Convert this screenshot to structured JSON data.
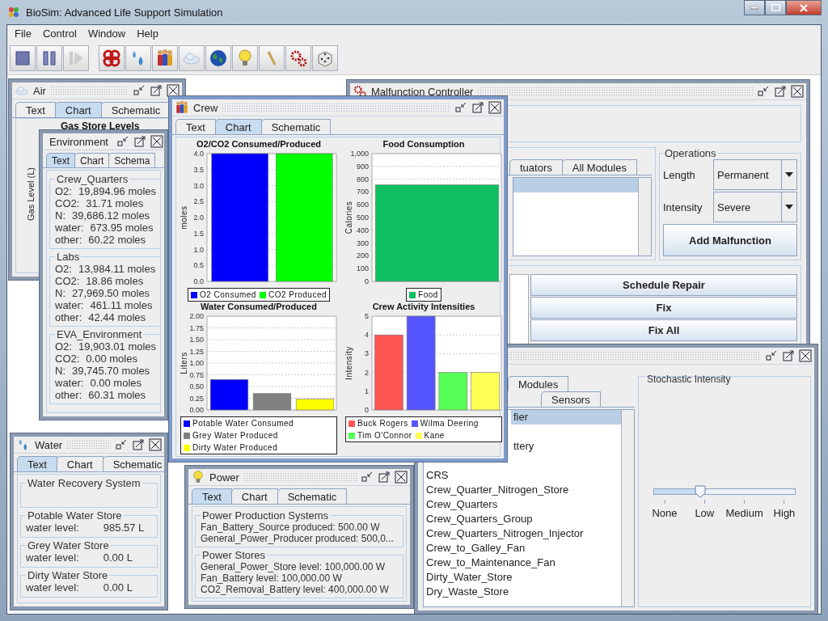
{
  "window": {
    "title": "BioSim: Advanced Life Support Simulation"
  },
  "menu": [
    "File",
    "Control",
    "Window",
    "Help"
  ],
  "toolbar": [
    {
      "kind": "stop",
      "disabled": false
    },
    {
      "kind": "pause",
      "disabled": false
    },
    {
      "kind": "step",
      "disabled": true
    },
    {
      "kind": "knot",
      "disabled": false
    },
    {
      "kind": "drops",
      "disabled": false
    },
    {
      "kind": "people",
      "disabled": false
    },
    {
      "kind": "cloud",
      "disabled": false
    },
    {
      "kind": "globe",
      "disabled": false
    },
    {
      "kind": "bulb",
      "disabled": false
    },
    {
      "kind": "stick",
      "disabled": false
    },
    {
      "kind": "gears",
      "disabled": false
    },
    {
      "kind": "dice",
      "disabled": false
    }
  ],
  "air": {
    "title": "Air",
    "tabs": [
      {
        "label": "Text",
        "selected": false
      },
      {
        "label": "Chart",
        "selected": true
      },
      {
        "label": "Schematic",
        "selected": false
      }
    ],
    "chart_title": "Gas Store Levels",
    "y_axis_label": "Gas Level (L)"
  },
  "malfunction": {
    "title": "Malfunction Controller",
    "tabs": [
      {
        "label": "tuators",
        "selected": false
      },
      {
        "label": "All Modules",
        "selected": false
      }
    ],
    "list_rows": [
      {
        "selected": true
      }
    ],
    "operations": {
      "title": "Operations",
      "fields": [
        {
          "label": "Length",
          "value": "Permanent"
        },
        {
          "label": "Intensity",
          "value": "Severe"
        }
      ],
      "button": "Add Malfunction"
    },
    "actions": [
      "Schedule Repair",
      "Fix",
      "Fix All"
    ]
  },
  "modules": {
    "top_tabs": [
      {
        "label": "Modules",
        "selected": false
      }
    ],
    "tabs": [
      {
        "label": "Sensors",
        "selected": false
      }
    ],
    "items": [
      {
        "label": "fier",
        "selected": true,
        "cut": true
      },
      {
        "label": "ttery",
        "selected": false,
        "cut": true
      },
      {
        "label": "CRS",
        "selected": false,
        "cut": false
      },
      {
        "label": "Crew_Quarter_Nitrogen_Store",
        "selected": false,
        "cut": false
      },
      {
        "label": "Crew_Quarters",
        "selected": false,
        "cut": false
      },
      {
        "label": "Crew_Quarters_Group",
        "selected": false,
        "cut": false
      },
      {
        "label": "Crew_Quarters_Nitrogen_Injector",
        "selected": false,
        "cut": false
      },
      {
        "label": "Crew_to_Galley_Fan",
        "selected": false,
        "cut": false
      },
      {
        "label": "Crew_to_Maintenance_Fan",
        "selected": false,
        "cut": false
      },
      {
        "label": "Dirty_Water_Store",
        "selected": false,
        "cut": false
      },
      {
        "label": "Dry_Waste_Store",
        "selected": false,
        "cut": false
      }
    ],
    "intensity": {
      "title": "Stochastic Intensity",
      "level": 0.33,
      "ticks": [
        "None",
        "Low",
        "Medium",
        "High"
      ]
    }
  },
  "environment": {
    "title": "Environment",
    "tabs": [
      {
        "label": "Text",
        "selected": true
      },
      {
        "label": "Chart",
        "selected": false
      },
      {
        "label": "Schema",
        "selected": false
      }
    ],
    "groups": [
      {
        "title": "Crew_Quarters",
        "rows": [
          {
            "label": "O2:",
            "value": "19,894.96 moles"
          },
          {
            "label": "CO2:",
            "value": "31.71 moles"
          },
          {
            "label": "N:",
            "value": "39,686.12 moles"
          },
          {
            "label": "water:",
            "value": "673.95 moles"
          },
          {
            "label": "other:",
            "value": "60.22 moles"
          }
        ]
      },
      {
        "title": "Labs",
        "rows": [
          {
            "label": "O2:",
            "value": "13,984.11 moles"
          },
          {
            "label": "CO2:",
            "value": "18.86 moles"
          },
          {
            "label": "N:",
            "value": "27,969.50 moles"
          },
          {
            "label": "water:",
            "value": "461.11 moles"
          },
          {
            "label": "other:",
            "value": "42.44 moles"
          }
        ]
      },
      {
        "title": "EVA_Environment",
        "rows": [
          {
            "label": "O2:",
            "value": "19,903.01 moles"
          },
          {
            "label": "CO2:",
            "value": "0.00 moles"
          },
          {
            "label": "N:",
            "value": "39,745.70 moles"
          },
          {
            "label": "water:",
            "value": "0.00 moles"
          },
          {
            "label": "other:",
            "value": "60.31 moles"
          }
        ]
      }
    ]
  },
  "water": {
    "title": "Water",
    "tabs": [
      {
        "label": "Text",
        "selected": true
      },
      {
        "label": "Chart",
        "selected": false
      },
      {
        "label": "Schematic",
        "selected": false
      }
    ],
    "groups": [
      {
        "title": "Water Recovery System"
      },
      {
        "title": "Potable Water Store",
        "rows": [
          {
            "label": "water level:",
            "value": "985.57 L"
          }
        ]
      },
      {
        "title": "Grey Water Store",
        "rows": [
          {
            "label": "water level:",
            "value": "0.00 L"
          }
        ]
      },
      {
        "title": "Dirty Water Store",
        "rows": [
          {
            "label": "water level:",
            "value": "0.00 L"
          }
        ]
      }
    ]
  },
  "power": {
    "title": "Power",
    "tabs": [
      {
        "label": "Text",
        "selected": true
      },
      {
        "label": "Chart",
        "selected": false
      },
      {
        "label": "Schematic",
        "selected": false
      }
    ],
    "groups": [
      {
        "title": "Power Production Systems",
        "lines": [
          "Fan_Battery_Source produced: 500.00 W",
          "General_Power_Producer produced: 500,0..."
        ]
      },
      {
        "title": "Power Stores",
        "lines": [
          "General_Power_Store level: 100,000.00 W",
          "Fan_Battery level: 100,000.00 W",
          "CO2_Removal_Battery level: 400,000.00 W"
        ]
      }
    ]
  },
  "crew": {
    "title": "Crew",
    "tabs": [
      {
        "label": "Text",
        "selected": false
      },
      {
        "label": "Chart",
        "selected": true
      },
      {
        "label": "Schematic",
        "selected": false
      }
    ],
    "charts": [
      {
        "chart_data": {
          "type": "bar",
          "grid": true,
          "title": "O2/CO2 Consumed/Produced",
          "ylabel": "moles",
          "ylim": [
            0,
            4
          ],
          "yticks": [
            {
              "value": 0,
              "label": "0.0"
            },
            {
              "value": 0.5,
              "label": "0.5"
            },
            {
              "value": 1,
              "label": "1.0"
            },
            {
              "value": 1.5,
              "label": "1.5"
            },
            {
              "value": 2,
              "label": "2.0"
            },
            {
              "value": 2.5,
              "label": "2.5"
            },
            {
              "value": 3,
              "label": "3.0"
            },
            {
              "value": 3.5,
              "label": "3.5"
            },
            {
              "value": 4,
              "label": "4.0"
            }
          ],
          "series": [
            {
              "name": "O2 Consumed",
              "color": "#0000ff",
              "values": [
                4.0
              ]
            },
            {
              "name": "CO2 Produced",
              "color": "#00ff00",
              "values": [
                4.0
              ]
            }
          ]
        }
      },
      {
        "chart_data": {
          "type": "bar",
          "grid": true,
          "title": "Food Consumption",
          "ylabel": "Calories",
          "ylim": [
            0,
            1000
          ],
          "yticks": [
            0,
            100,
            200,
            300,
            400,
            500,
            600,
            700,
            800,
            900,
            {
              "value": 1000,
              "label": "1,000"
            }
          ],
          "series": [
            {
              "name": "Food",
              "color": "#10c060",
              "values": [
                755
              ]
            }
          ]
        }
      },
      {
        "chart_data": {
          "type": "bar",
          "grid": true,
          "title": "Water Consumed/Produced",
          "ylabel": "Liters",
          "ylim": [
            0,
            2
          ],
          "yticks": [
            {
              "value": 0,
              "label": "0.00"
            },
            {
              "value": 0.25,
              "label": "0.25"
            },
            {
              "value": 0.5,
              "label": "0.50"
            },
            {
              "value": 0.75,
              "label": "0.75"
            },
            {
              "value": 1,
              "label": "1.00"
            },
            {
              "value": 1.25,
              "label": "1.25"
            },
            {
              "value": 1.5,
              "label": "1.50"
            },
            {
              "value": 1.75,
              "label": "1.75"
            },
            {
              "value": 2,
              "label": "2.00"
            }
          ],
          "series": [
            {
              "name": "Potable Water Consumed",
              "color": "#0000ff",
              "values": [
                0.65
              ]
            },
            {
              "name": "Grey Water Produced",
              "color": "#808080",
              "values": [
                0.35
              ]
            },
            {
              "name": "Dirty Water Produced",
              "color": "#ffff00",
              "values": [
                0.23
              ]
            }
          ]
        }
      },
      {
        "chart_data": {
          "type": "bar",
          "grid": true,
          "title": "Crew Activity Intensities",
          "ylabel": "Intensity",
          "ylim": [
            0,
            5
          ],
          "yticks": [
            0,
            1,
            2,
            3,
            4,
            5
          ],
          "series": [
            {
              "name": "Buck Rogers",
              "color": "#ff5555",
              "values": [
                4
              ]
            },
            {
              "name": "Wilma Deering",
              "color": "#5555ff",
              "values": [
                5
              ]
            },
            {
              "name": "Tim O'Connor",
              "color": "#55ff55",
              "values": [
                2
              ]
            },
            {
              "name": "Kane",
              "color": "#ffff55",
              "values": [
                2
              ]
            }
          ]
        }
      }
    ]
  }
}
